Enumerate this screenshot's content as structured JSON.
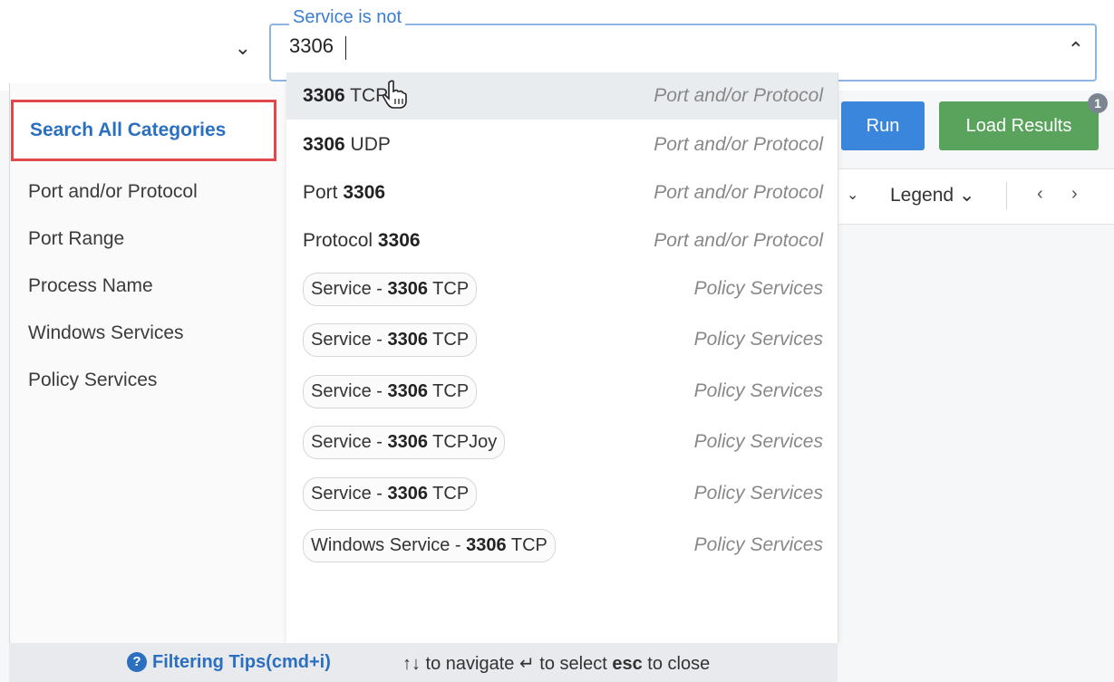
{
  "filter": {
    "legend": "Service is not",
    "value": "3306"
  },
  "buttons": {
    "run": "Run",
    "load_results": "Load Results",
    "load_badge": "1"
  },
  "toolbar": {
    "legend_label": "Legend ⌄"
  },
  "categories": {
    "selected": "Search All Categories",
    "items": [
      "Port and/or Protocol",
      "Port Range",
      "Process Name",
      "Windows Services",
      "Policy Services"
    ]
  },
  "results": [
    {
      "bold": "3306",
      "rest": " TCP",
      "category": "Port and/or Protocol"
    },
    {
      "bold": "3306",
      "rest": " UDP",
      "category": "Port and/or Protocol"
    },
    {
      "pre": "Port ",
      "bold": "3306",
      "category": "Port and/or Protocol"
    },
    {
      "pre": "Protocol ",
      "bold": "3306",
      "category": "Port and/or Protocol"
    },
    {
      "pre": "Service - ",
      "bold": "3306",
      "rest": " TCP",
      "category": "Policy Services"
    },
    {
      "pre": "Service - ",
      "bold": "3306",
      "rest": " TCP",
      "category": "Policy Services"
    },
    {
      "pre": "Service - ",
      "bold": "3306",
      "rest": " TCP",
      "category": "Policy Services"
    },
    {
      "pre": "Service - ",
      "bold": "3306",
      "rest": " TCPJoy",
      "category": "Policy Services"
    },
    {
      "pre": "Service - ",
      "bold": "3306",
      "rest": " TCP",
      "category": "Policy Services"
    },
    {
      "pre": "Windows Service - ",
      "bold": "3306",
      "rest": " TCP",
      "category": "Policy Services"
    }
  ],
  "footer": {
    "tips": "Filtering Tips(cmd+i)",
    "nav_arrows": "↑↓",
    "nav_text": " to navigate ",
    "select_icon": "↵",
    "select_text": " to select ",
    "esc_key": "esc",
    "close_text": " to close"
  },
  "colors": {
    "accent": "#2a6fc0",
    "run": "#3b86dd",
    "load": "#5aa35d",
    "highlight_border": "#e0484b"
  }
}
